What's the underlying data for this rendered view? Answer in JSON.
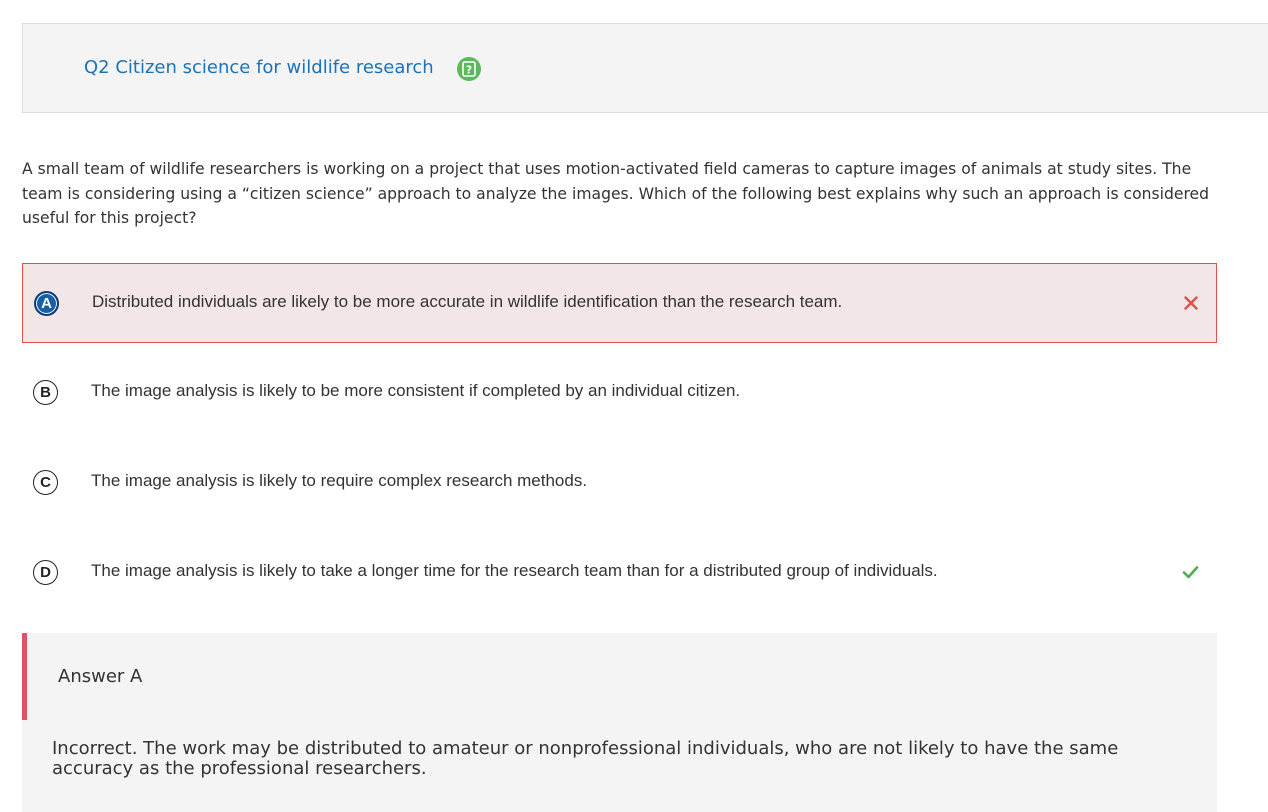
{
  "question": {
    "title": "Q2 Citizen science for wildlife research",
    "help_icon": "question-mark-icon",
    "stem": "A small team of wildlife researchers is working on a project that uses motion-activated field cameras to capture images of animals at study sites. The team is considering using a “citizen science” approach to analyze the images. Which of the following best explains why such an approach is considered useful for this project?"
  },
  "options": [
    {
      "letter": "A",
      "text": "Distributed individuals are likely to be more accurate in wildlife identification than the research team.",
      "status": "selected-incorrect"
    },
    {
      "letter": "B",
      "text": "The image analysis is likely to be more consistent if completed by an individual citizen.",
      "status": "none"
    },
    {
      "letter": "C",
      "text": "The image analysis is likely to require complex research methods.",
      "status": "none"
    },
    {
      "letter": "D",
      "text": "The image analysis is likely to take a longer time for the research team than for a distributed group of individuals.",
      "status": "correct"
    }
  ],
  "feedback": {
    "title": "Answer A",
    "text": "Incorrect. The work may be distributed to amateur or nonprofessional individuals, who are not likely to have the same accuracy as the professional researchers."
  },
  "colors": {
    "title": "#1a73b8",
    "incorrect": "#d9534f",
    "correct": "#4cae4c",
    "help": "#5cb85c",
    "selected_letter": "#1a5ea8"
  }
}
